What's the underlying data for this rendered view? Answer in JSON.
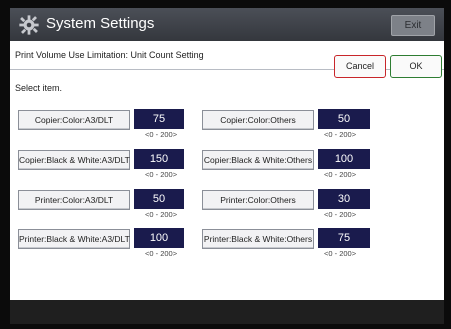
{
  "header": {
    "title": "System Settings",
    "exit_label": "Exit"
  },
  "setting": {
    "title": "Print Volume Use Limitation: Unit Count Setting",
    "cancel_label": "Cancel",
    "ok_label": "OK",
    "instruction": "Select item."
  },
  "items": [
    {
      "label": "Copier:Color:A3/DLT",
      "value": "75",
      "range": "<0 - 200>"
    },
    {
      "label": "Copier:Color:Others",
      "value": "50",
      "range": "<0 - 200>"
    },
    {
      "label": "Copier:Black & White:A3/DLT",
      "value": "150",
      "range": "<0 - 200>"
    },
    {
      "label": "Copier:Black & White:Others",
      "value": "100",
      "range": "<0 - 200>"
    },
    {
      "label": "Printer:Color:A3/DLT",
      "value": "50",
      "range": "<0 - 200>"
    },
    {
      "label": "Printer:Color:Others",
      "value": "30",
      "range": "<0 - 200>"
    },
    {
      "label": "Printer:Black & White:A3/DLT",
      "value": "100",
      "range": "<0 - 200>"
    },
    {
      "label": "Printer:Black & White:Others",
      "value": "75",
      "range": "<0 - 200>"
    }
  ],
  "icons": {
    "settings": "gear-icon"
  }
}
